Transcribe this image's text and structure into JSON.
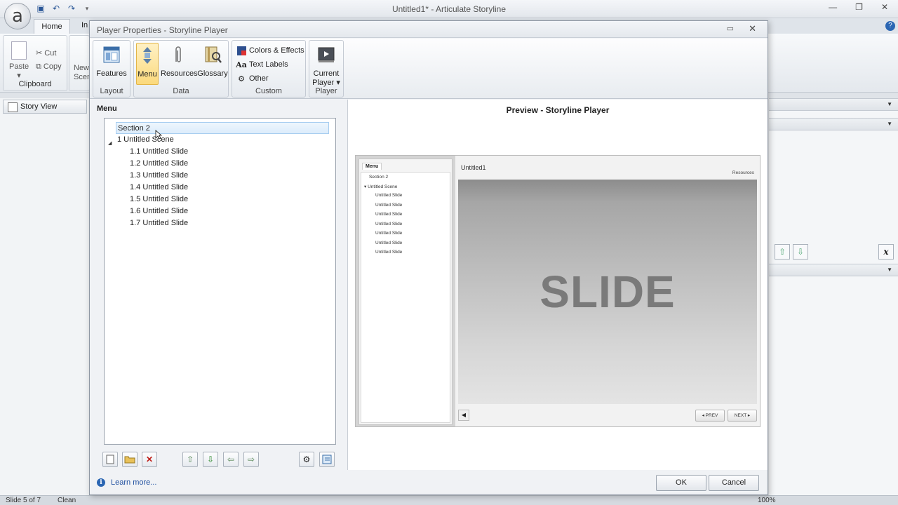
{
  "app": {
    "title": "Untitled1* -  Articulate Storyline",
    "logo_letter": "a",
    "tabs": {
      "home": "Home",
      "insert": "In"
    },
    "clipboard": {
      "paste": "Paste",
      "cut": "Cut",
      "copy": "Copy",
      "group": "Clipboard"
    },
    "new_scene": "New\nScen",
    "story_view": "Story View",
    "status": {
      "slide": "Slide 5 of 7",
      "state": "Clean",
      "zoom": "100%"
    }
  },
  "dialog": {
    "title": "Player Properties - Storyline Player",
    "ribbon": {
      "layout": {
        "label": "Layout",
        "features": "Features"
      },
      "data": {
        "label": "Data",
        "menu": "Menu",
        "resources": "Resources",
        "glossary": "Glossary"
      },
      "custom": {
        "label": "Custom",
        "colors": "Colors & Effects",
        "text_labels": "Text Labels",
        "other": "Other"
      },
      "player": {
        "label": "Player",
        "current_1": "Current",
        "current_2": "Player ▾"
      }
    },
    "menu_heading": "Menu",
    "tree": [
      {
        "text": "Section 2",
        "indent": 0,
        "selected": true
      },
      {
        "text": "1 Untitled Scene",
        "indent": 0,
        "expandable": true
      },
      {
        "text": "1.1 Untitled Slide",
        "indent": 1
      },
      {
        "text": "1.2 Untitled Slide",
        "indent": 1
      },
      {
        "text": "1.3 Untitled Slide",
        "indent": 1
      },
      {
        "text": "1.4 Untitled Slide",
        "indent": 1
      },
      {
        "text": "1.5 Untitled Slide",
        "indent": 1
      },
      {
        "text": "1.6 Untitled Slide",
        "indent": 1
      },
      {
        "text": "1.7 Untitled Slide",
        "indent": 1
      }
    ],
    "preview": {
      "heading": "Preview - Storyline Player",
      "menu_tab": "Menu",
      "items": [
        "Section 2",
        "Untitled Scene",
        "Untitled Slide",
        "Untitled Slide",
        "Untitled Slide",
        "Untitled Slide",
        "Untitled Slide",
        "Untitled Slide",
        "Untitled Slide"
      ],
      "slide_title": "Untitled1",
      "resources": "Resources",
      "slide_text": "SLIDE",
      "prev": "◂ PREV",
      "next": "NEXT ▸"
    },
    "learn_more": "Learn more...",
    "ok": "OK",
    "cancel": "Cancel"
  },
  "colors": {
    "accent_active": "#fbd97c",
    "link": "#2050a0",
    "selection": "#dcecfb"
  }
}
